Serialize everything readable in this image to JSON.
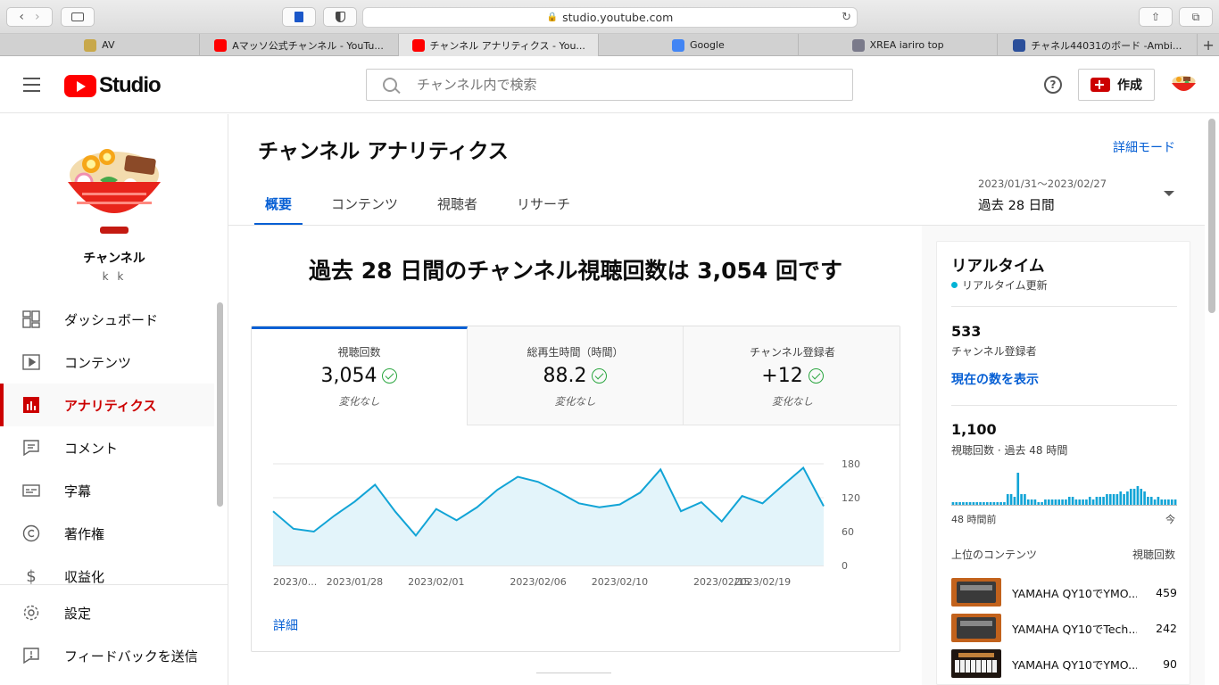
{
  "browser": {
    "url": "studio.youtube.com",
    "tabs": [
      {
        "label": "AV",
        "favicon_color": "#c8a84a"
      },
      {
        "label": "Aマッソ公式チャンネル - YouTu...",
        "favicon_color": "#ff0000"
      },
      {
        "label": "チャンネル アナリティクス - You...",
        "favicon_color": "#ff0000"
      },
      {
        "label": "Google",
        "favicon_color": "#4285f4"
      },
      {
        "label": "XREA iariro top",
        "favicon_color": "#7a7a8a"
      },
      {
        "label": "チャネル44031のボード -Ambi...",
        "favicon_color": "#2b4f9a"
      }
    ],
    "new_tab_label": "+"
  },
  "header": {
    "logo_text": "Studio",
    "search_placeholder": "チャンネル内で検索",
    "help_glyph": "?",
    "create_label": "作成"
  },
  "sidebar": {
    "channel_name": "チャンネル",
    "channel_handle": "k k",
    "items": [
      {
        "label": "ダッシュボード",
        "icon": "dashboard-icon"
      },
      {
        "label": "コンテンツ",
        "icon": "content-icon"
      },
      {
        "label": "アナリティクス",
        "icon": "analytics-icon"
      },
      {
        "label": "コメント",
        "icon": "comments-icon"
      },
      {
        "label": "字幕",
        "icon": "subtitles-icon"
      },
      {
        "label": "著作権",
        "icon": "copyright-icon"
      },
      {
        "label": "収益化",
        "icon": "monetization-icon"
      }
    ],
    "bottom_items": [
      {
        "label": "設定",
        "icon": "settings-icon"
      },
      {
        "label": "フィードバックを送信",
        "icon": "feedback-icon"
      }
    ]
  },
  "main": {
    "title": "チャンネル アナリティクス",
    "advanced_mode": "詳細モード",
    "tabs": [
      "概要",
      "コンテンツ",
      "視聴者",
      "リサーチ"
    ],
    "date_range": {
      "dates": "2023/01/31〜2023/02/27",
      "label": "過去 28 日間"
    },
    "headline": "過去 28 日間のチャンネル視聴回数は 3,054 回です",
    "metrics": [
      {
        "label": "視聴回数",
        "value": "3,054",
        "change": "変化なし"
      },
      {
        "label": "総再生時間（時間）",
        "value": "88.2",
        "change": "変化なし"
      },
      {
        "label": "チャンネル登録者",
        "value": "+12",
        "change": "変化なし"
      }
    ],
    "detail_link": "詳細"
  },
  "chart_data": {
    "type": "area",
    "series": [
      {
        "values": [
          96,
          65,
          60,
          88,
          113,
          143,
          95,
          53,
          100,
          80,
          103,
          134,
          157,
          148,
          130,
          110,
          103,
          108,
          129,
          170,
          96,
          112,
          78,
          123,
          110,
          142,
          173,
          105
        ]
      }
    ],
    "x_tick_labels": [
      "2023/0...",
      "2023/01/28",
      "2023/02/01",
      "2023/02/06",
      "2023/02/10",
      "2023/02/15",
      "2023/02/19"
    ],
    "y_tick_labels": [
      "180",
      "120",
      "60",
      "0"
    ],
    "ylim": [
      0,
      180
    ],
    "grid": true,
    "color": "#12a4d6"
  },
  "realtime": {
    "title": "リアルタイム",
    "live_label": "リアルタイム更新",
    "subscribers": "533",
    "subscribers_label": "チャンネル登録者",
    "show_count_link": "現在の数を表示",
    "views": "1,100",
    "views_label": "視聴回数 · 過去 48 時間",
    "bars": [
      1,
      1,
      1,
      1,
      1,
      1,
      1,
      1,
      1,
      1,
      1,
      1,
      1,
      1,
      1,
      1,
      1,
      1,
      1,
      1,
      1,
      1,
      1,
      2,
      1,
      1,
      1,
      1,
      1,
      1,
      1,
      1,
      1,
      1,
      1,
      1,
      1,
      1,
      1,
      1,
      1,
      1,
      1,
      1,
      1,
      1,
      1,
      1,
      1,
      2,
      2,
      2,
      2,
      3,
      3,
      1,
      1,
      2,
      2,
      2,
      2,
      1,
      1,
      1,
      1,
      1
    ],
    "bars_detail": [
      1,
      1,
      1,
      1,
      1,
      1,
      1,
      1,
      1,
      1,
      1,
      1,
      1,
      1,
      1,
      1,
      4,
      4,
      3,
      12,
      4,
      4,
      2,
      2,
      2,
      1,
      1,
      2,
      2,
      2,
      2,
      2,
      2,
      2,
      3,
      3,
      2,
      2,
      2,
      2,
      3,
      2,
      3,
      3,
      3,
      4,
      4,
      4,
      4,
      5,
      4,
      5,
      6,
      6,
      7,
      6,
      5,
      3,
      3,
      2,
      3,
      2,
      2,
      2,
      2,
      2
    ],
    "axis_left": "48 時間前",
    "axis_right": "今",
    "top_header": "上位のコンテンツ",
    "top_header_right": "視聴回数",
    "top_content": [
      {
        "title": "YAMAHA QY10でYMO...",
        "views": "459"
      },
      {
        "title": "YAMAHA QY10でTech...",
        "views": "242"
      },
      {
        "title": "YAMAHA QY10でYMO...",
        "views": "90"
      }
    ]
  }
}
